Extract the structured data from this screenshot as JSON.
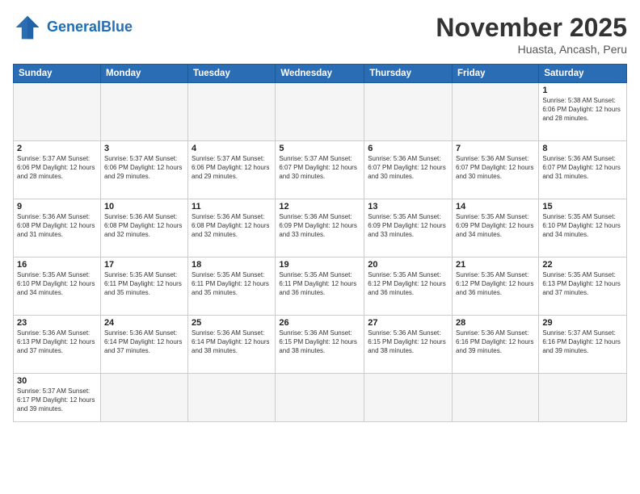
{
  "header": {
    "logo_general": "General",
    "logo_blue": "Blue",
    "title": "November 2025",
    "subtitle": "Huasta, Ancash, Peru"
  },
  "weekdays": [
    "Sunday",
    "Monday",
    "Tuesday",
    "Wednesday",
    "Thursday",
    "Friday",
    "Saturday"
  ],
  "weeks": [
    [
      {
        "day": "",
        "info": ""
      },
      {
        "day": "",
        "info": ""
      },
      {
        "day": "",
        "info": ""
      },
      {
        "day": "",
        "info": ""
      },
      {
        "day": "",
        "info": ""
      },
      {
        "day": "",
        "info": ""
      },
      {
        "day": "1",
        "info": "Sunrise: 5:38 AM\nSunset: 6:06 PM\nDaylight: 12 hours and 28 minutes."
      }
    ],
    [
      {
        "day": "2",
        "info": "Sunrise: 5:37 AM\nSunset: 6:06 PM\nDaylight: 12 hours and 28 minutes."
      },
      {
        "day": "3",
        "info": "Sunrise: 5:37 AM\nSunset: 6:06 PM\nDaylight: 12 hours and 29 minutes."
      },
      {
        "day": "4",
        "info": "Sunrise: 5:37 AM\nSunset: 6:06 PM\nDaylight: 12 hours and 29 minutes."
      },
      {
        "day": "5",
        "info": "Sunrise: 5:37 AM\nSunset: 6:07 PM\nDaylight: 12 hours and 30 minutes."
      },
      {
        "day": "6",
        "info": "Sunrise: 5:36 AM\nSunset: 6:07 PM\nDaylight: 12 hours and 30 minutes."
      },
      {
        "day": "7",
        "info": "Sunrise: 5:36 AM\nSunset: 6:07 PM\nDaylight: 12 hours and 30 minutes."
      },
      {
        "day": "8",
        "info": "Sunrise: 5:36 AM\nSunset: 6:07 PM\nDaylight: 12 hours and 31 minutes."
      }
    ],
    [
      {
        "day": "9",
        "info": "Sunrise: 5:36 AM\nSunset: 6:08 PM\nDaylight: 12 hours and 31 minutes."
      },
      {
        "day": "10",
        "info": "Sunrise: 5:36 AM\nSunset: 6:08 PM\nDaylight: 12 hours and 32 minutes."
      },
      {
        "day": "11",
        "info": "Sunrise: 5:36 AM\nSunset: 6:08 PM\nDaylight: 12 hours and 32 minutes."
      },
      {
        "day": "12",
        "info": "Sunrise: 5:36 AM\nSunset: 6:09 PM\nDaylight: 12 hours and 33 minutes."
      },
      {
        "day": "13",
        "info": "Sunrise: 5:35 AM\nSunset: 6:09 PM\nDaylight: 12 hours and 33 minutes."
      },
      {
        "day": "14",
        "info": "Sunrise: 5:35 AM\nSunset: 6:09 PM\nDaylight: 12 hours and 34 minutes."
      },
      {
        "day": "15",
        "info": "Sunrise: 5:35 AM\nSunset: 6:10 PM\nDaylight: 12 hours and 34 minutes."
      }
    ],
    [
      {
        "day": "16",
        "info": "Sunrise: 5:35 AM\nSunset: 6:10 PM\nDaylight: 12 hours and 34 minutes."
      },
      {
        "day": "17",
        "info": "Sunrise: 5:35 AM\nSunset: 6:11 PM\nDaylight: 12 hours and 35 minutes."
      },
      {
        "day": "18",
        "info": "Sunrise: 5:35 AM\nSunset: 6:11 PM\nDaylight: 12 hours and 35 minutes."
      },
      {
        "day": "19",
        "info": "Sunrise: 5:35 AM\nSunset: 6:11 PM\nDaylight: 12 hours and 36 minutes."
      },
      {
        "day": "20",
        "info": "Sunrise: 5:35 AM\nSunset: 6:12 PM\nDaylight: 12 hours and 36 minutes."
      },
      {
        "day": "21",
        "info": "Sunrise: 5:35 AM\nSunset: 6:12 PM\nDaylight: 12 hours and 36 minutes."
      },
      {
        "day": "22",
        "info": "Sunrise: 5:35 AM\nSunset: 6:13 PM\nDaylight: 12 hours and 37 minutes."
      }
    ],
    [
      {
        "day": "23",
        "info": "Sunrise: 5:36 AM\nSunset: 6:13 PM\nDaylight: 12 hours and 37 minutes."
      },
      {
        "day": "24",
        "info": "Sunrise: 5:36 AM\nSunset: 6:14 PM\nDaylight: 12 hours and 37 minutes."
      },
      {
        "day": "25",
        "info": "Sunrise: 5:36 AM\nSunset: 6:14 PM\nDaylight: 12 hours and 38 minutes."
      },
      {
        "day": "26",
        "info": "Sunrise: 5:36 AM\nSunset: 6:15 PM\nDaylight: 12 hours and 38 minutes."
      },
      {
        "day": "27",
        "info": "Sunrise: 5:36 AM\nSunset: 6:15 PM\nDaylight: 12 hours and 38 minutes."
      },
      {
        "day": "28",
        "info": "Sunrise: 5:36 AM\nSunset: 6:16 PM\nDaylight: 12 hours and 39 minutes."
      },
      {
        "day": "29",
        "info": "Sunrise: 5:37 AM\nSunset: 6:16 PM\nDaylight: 12 hours and 39 minutes."
      }
    ],
    [
      {
        "day": "30",
        "info": "Sunrise: 5:37 AM\nSunset: 6:17 PM\nDaylight: 12 hours and 39 minutes."
      },
      {
        "day": "",
        "info": ""
      },
      {
        "day": "",
        "info": ""
      },
      {
        "day": "",
        "info": ""
      },
      {
        "day": "",
        "info": ""
      },
      {
        "day": "",
        "info": ""
      },
      {
        "day": "",
        "info": ""
      }
    ]
  ]
}
